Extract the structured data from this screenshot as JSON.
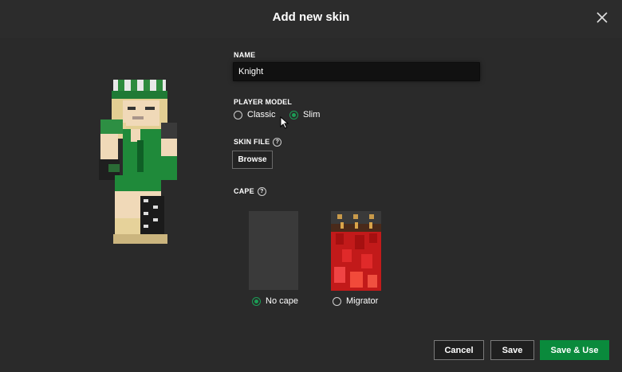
{
  "dialog": {
    "title": "Add new skin"
  },
  "form": {
    "name_label": "NAME",
    "name_value": "Knight",
    "player_model_label": "PLAYER MODEL",
    "player_model_options": [
      "Classic",
      "Slim"
    ],
    "player_model_selected": "Slim",
    "skin_file_label": "SKIN FILE",
    "help_glyph": "?",
    "browse_label": "Browse",
    "cape_label": "CAPE",
    "cape_options": [
      "No cape",
      "Migrator"
    ],
    "cape_selected": "No cape"
  },
  "footer": {
    "cancel_label": "Cancel",
    "save_label": "Save",
    "save_use_label": "Save & Use"
  },
  "colors": {
    "background": "#2a2a2a",
    "accent_green": "#0a8a3c",
    "radio_selected": "#1b9e55",
    "input_background": "#111111"
  },
  "icons": {
    "close": "close-icon",
    "help": "help-icon",
    "cursor": "mouse-pointer-icon"
  }
}
